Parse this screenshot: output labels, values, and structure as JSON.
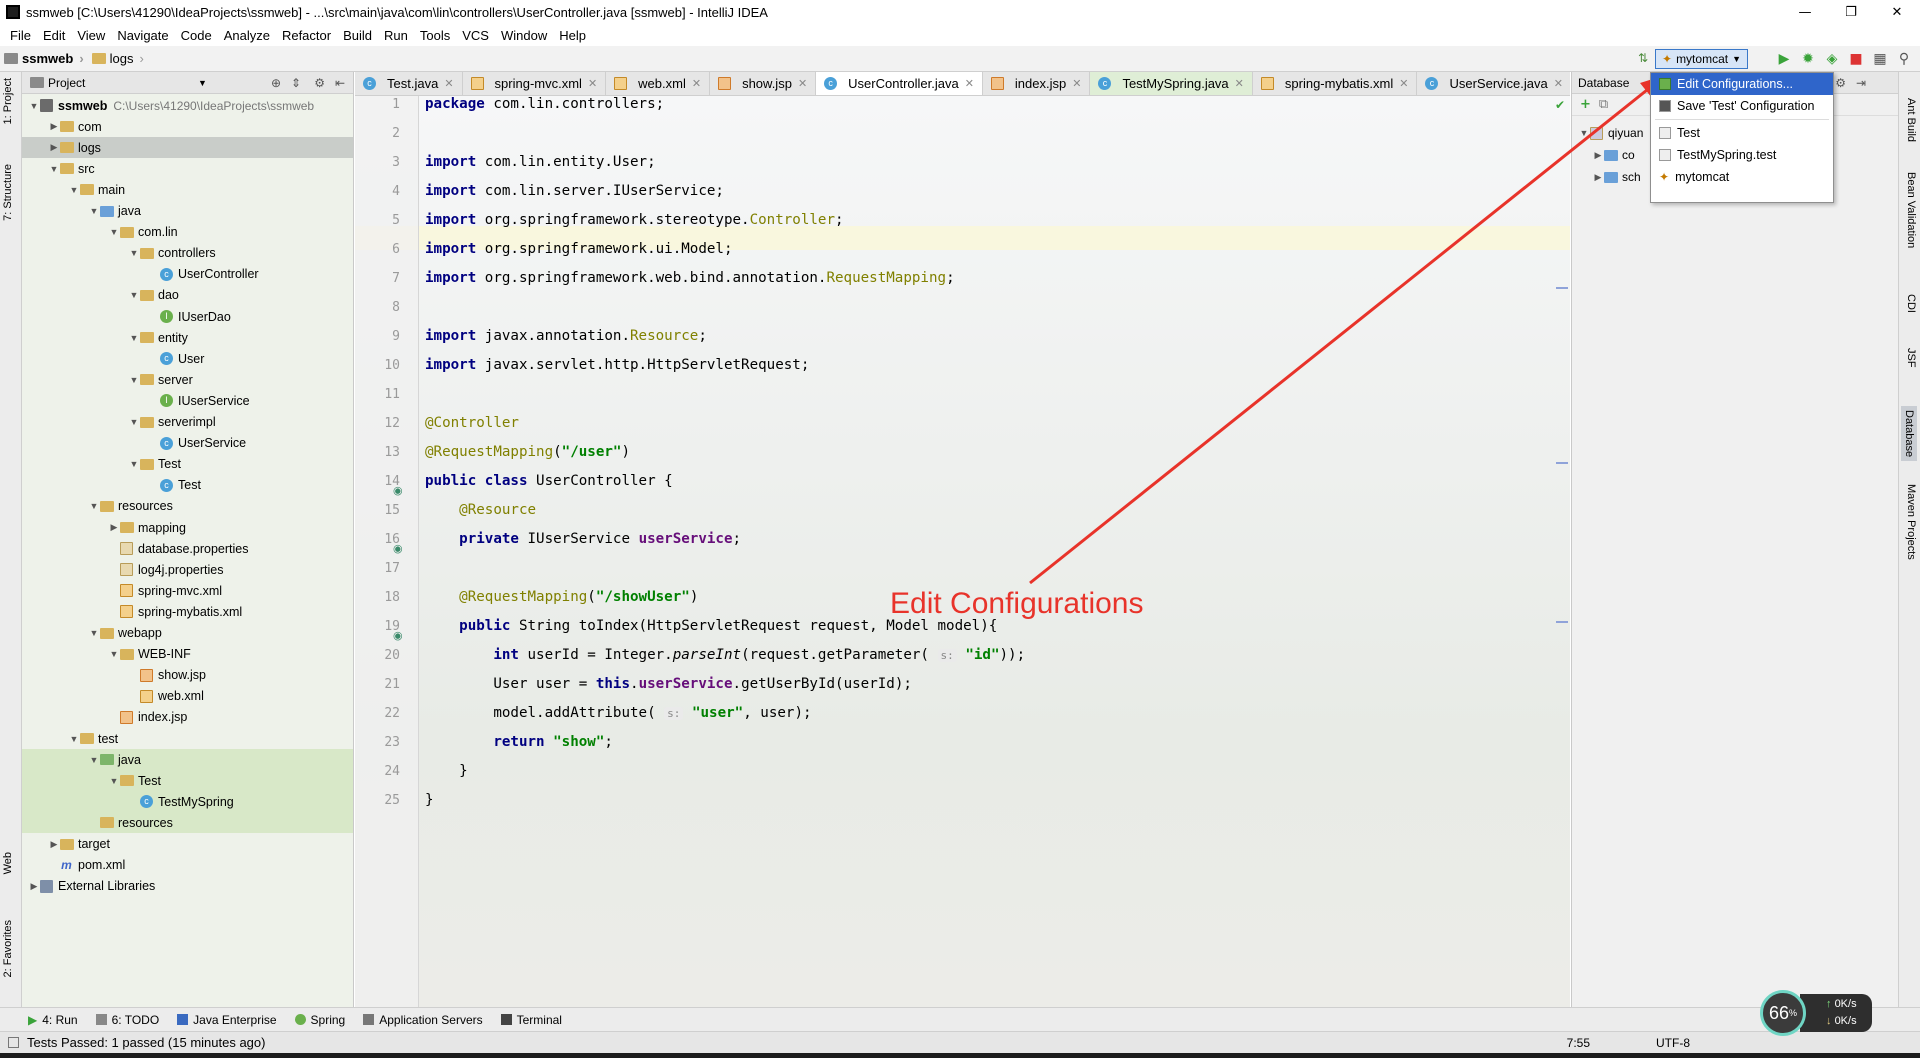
{
  "window": {
    "title": "ssmweb [C:\\Users\\41290\\IdeaProjects\\ssmweb] - ...\\src\\main\\java\\com\\lin\\controllers\\UserController.java [ssmweb] - IntelliJ IDEA",
    "minimize": "—",
    "maximize": "❐",
    "close": "✕"
  },
  "menu": [
    "File",
    "Edit",
    "View",
    "Navigate",
    "Code",
    "Analyze",
    "Refactor",
    "Build",
    "Run",
    "Tools",
    "VCS",
    "Window",
    "Help"
  ],
  "nav": {
    "crumbs": [
      "ssmweb",
      "logs"
    ],
    "run_config": "mytomcat"
  },
  "left_strip": {
    "project": "1: Project",
    "structure": "7: Structure",
    "web": "Web",
    "favorites": "2: Favorites"
  },
  "right_strip": [
    "Ant Build",
    "Bean Validation",
    "CDI",
    "JSF",
    "Database",
    "Maven Projects"
  ],
  "project_panel": {
    "header": "Project",
    "tree": [
      {
        "label": "ssmweb",
        "extra": "C:\\Users\\41290\\IdeaProjects\\ssmweb",
        "depth": 0,
        "icon": "mod",
        "open": true,
        "bold": true
      },
      {
        "label": "com",
        "depth": 1,
        "icon": "folder",
        "open": false
      },
      {
        "label": "logs",
        "depth": 1,
        "icon": "folder",
        "open": false,
        "selected": true
      },
      {
        "label": "src",
        "depth": 1,
        "icon": "folder",
        "open": true
      },
      {
        "label": "main",
        "depth": 2,
        "icon": "folder",
        "open": true
      },
      {
        "label": "java",
        "depth": 3,
        "icon": "folder-blue",
        "open": true
      },
      {
        "label": "com.lin",
        "depth": 4,
        "icon": "folder",
        "open": true
      },
      {
        "label": "controllers",
        "depth": 5,
        "icon": "folder",
        "open": true
      },
      {
        "label": "UserController",
        "depth": 6,
        "icon": "class"
      },
      {
        "label": "dao",
        "depth": 5,
        "icon": "folder",
        "open": true
      },
      {
        "label": "IUserDao",
        "depth": 6,
        "icon": "iface"
      },
      {
        "label": "entity",
        "depth": 5,
        "icon": "folder",
        "open": true
      },
      {
        "label": "User",
        "depth": 6,
        "icon": "class"
      },
      {
        "label": "server",
        "depth": 5,
        "icon": "folder",
        "open": true
      },
      {
        "label": "IUserService",
        "depth": 6,
        "icon": "iface"
      },
      {
        "label": "serverimpl",
        "depth": 5,
        "icon": "folder",
        "open": true
      },
      {
        "label": "UserService",
        "depth": 6,
        "icon": "class"
      },
      {
        "label": "Test",
        "depth": 5,
        "icon": "folder",
        "open": true
      },
      {
        "label": "Test",
        "depth": 6,
        "icon": "class"
      },
      {
        "label": "resources",
        "depth": 3,
        "icon": "folder",
        "open": true
      },
      {
        "label": "mapping",
        "depth": 4,
        "icon": "folder",
        "open": false
      },
      {
        "label": "database.properties",
        "depth": 4,
        "icon": "file"
      },
      {
        "label": "log4j.properties",
        "depth": 4,
        "icon": "file"
      },
      {
        "label": "spring-mvc.xml",
        "depth": 4,
        "icon": "xml"
      },
      {
        "label": "spring-mybatis.xml",
        "depth": 4,
        "icon": "xml"
      },
      {
        "label": "webapp",
        "depth": 3,
        "icon": "folder",
        "open": true
      },
      {
        "label": "WEB-INF",
        "depth": 4,
        "icon": "folder",
        "open": true
      },
      {
        "label": "show.jsp",
        "depth": 5,
        "icon": "jsp"
      },
      {
        "label": "web.xml",
        "depth": 5,
        "icon": "xml"
      },
      {
        "label": "index.jsp",
        "depth": 4,
        "icon": "jsp"
      },
      {
        "label": "test",
        "depth": 2,
        "icon": "folder",
        "open": true
      },
      {
        "label": "java",
        "depth": 3,
        "icon": "folder-green",
        "open": true,
        "green": true
      },
      {
        "label": "Test",
        "depth": 4,
        "icon": "folder",
        "open": true,
        "green": true
      },
      {
        "label": "TestMySpring",
        "depth": 5,
        "icon": "class",
        "green": true
      },
      {
        "label": "resources",
        "depth": 3,
        "icon": "folder",
        "green": true
      },
      {
        "label": "target",
        "depth": 1,
        "icon": "folder",
        "open": false
      },
      {
        "label": "pom.xml",
        "depth": 1,
        "icon": "m"
      },
      {
        "label": "External Libraries",
        "depth": 0,
        "icon": "lib",
        "open": false
      }
    ]
  },
  "editor_tabs": [
    {
      "label": "Test.java",
      "kind": "class"
    },
    {
      "label": "spring-mvc.xml",
      "kind": "xml"
    },
    {
      "label": "web.xml",
      "kind": "xml"
    },
    {
      "label": "show.jsp",
      "kind": "jsp"
    },
    {
      "label": "UserController.java",
      "kind": "class",
      "active": true
    },
    {
      "label": "index.jsp",
      "kind": "jsp"
    },
    {
      "label": "TestMySpring.java",
      "kind": "class",
      "green": true
    },
    {
      "label": "spring-mybatis.xml",
      "kind": "xml"
    },
    {
      "label": "UserService.java",
      "kind": "class"
    }
  ],
  "code_lines": [
    "1",
    "2",
    "3",
    "4",
    "5",
    "6",
    "7",
    "8",
    "9",
    "10",
    "11",
    "12",
    "13",
    "14",
    "15",
    "16",
    "17",
    "18",
    "19",
    "20",
    "21",
    "22",
    "23",
    "24",
    "25"
  ],
  "db_panel": {
    "header": "Database",
    "items": [
      "qiyuan",
      "co",
      "sch"
    ]
  },
  "run_menu": {
    "items": [
      {
        "label": "Edit Configurations...",
        "selected": true
      },
      {
        "label": "Save 'Test' Configuration"
      },
      {
        "label": "Test"
      },
      {
        "label": "TestMySpring.test"
      },
      {
        "label": "mytomcat"
      }
    ]
  },
  "annotation": "Edit Configurations",
  "bottom_tools": [
    "4: Run",
    "6: TODO",
    "Java Enterprise",
    "Spring",
    "Application Servers",
    "Terminal"
  ],
  "status": {
    "text": "Tests Passed: 1 passed (15 minutes ago)",
    "position": "7:55",
    "encoding": "UTF-8"
  },
  "widget": {
    "cpu": "66",
    "cpu_unit": "%",
    "up": "0K/s",
    "down": "0K/s"
  },
  "colors": {
    "accent": "#2f65ca",
    "annotation": "#e8332a",
    "keyword": "#000080",
    "annotation_code": "#808000",
    "string": "#008000"
  }
}
